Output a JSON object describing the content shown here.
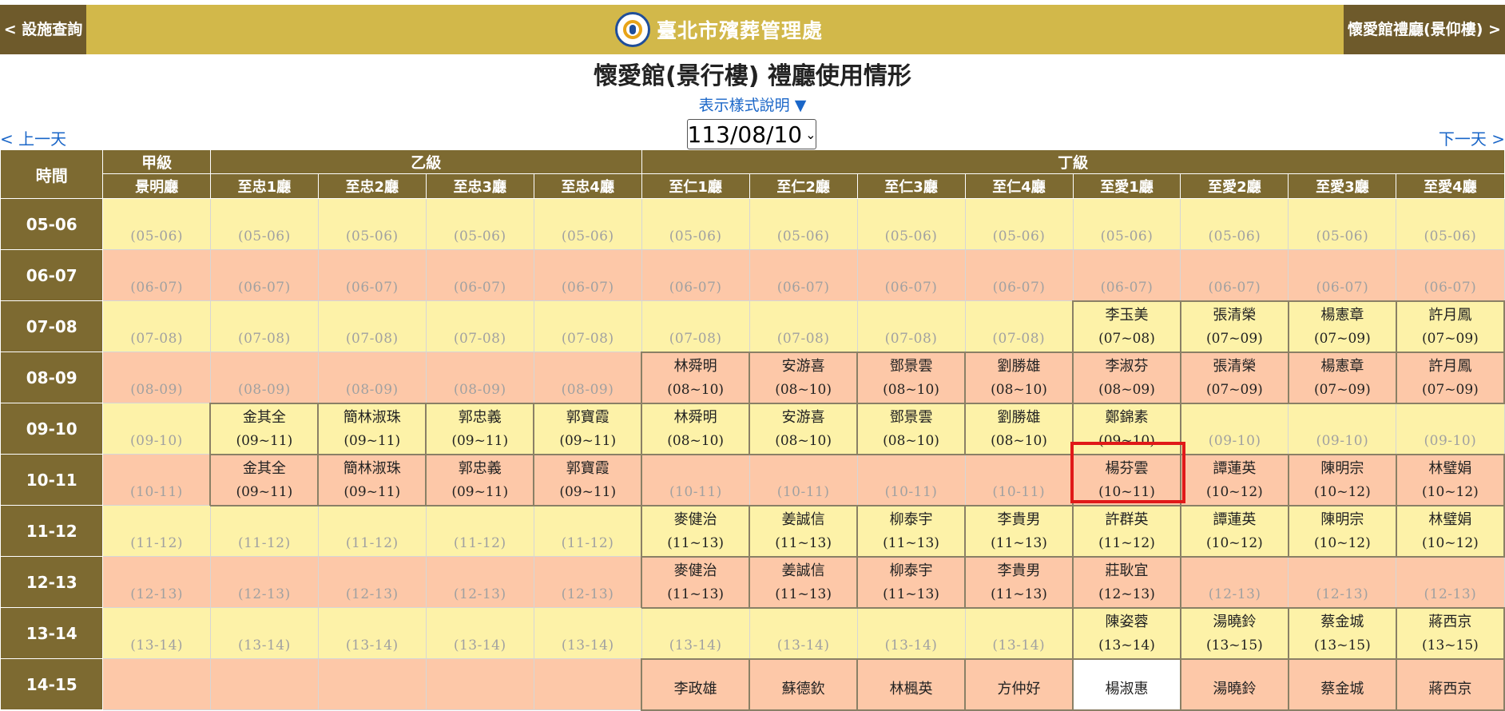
{
  "header": {
    "back_link": "< 設施查詢",
    "org_name": "臺北市殯葬管理處",
    "next_venue_link": "懷愛館禮廳(景仰樓) >"
  },
  "page_title": "懷愛館(景行樓) 禮廳使用情形",
  "legend_toggle": "表示樣式說明 ▼",
  "date_nav": {
    "prev": "< 上一天",
    "next": "下一天 >",
    "selected_date": "113/08/10"
  },
  "colors": {
    "banner": "#d2b84a",
    "header_cell": "#7d6a31",
    "row_yellow": "#fdf2a8",
    "row_peach": "#fdc8a8",
    "highlight": "#e01919",
    "link": "#1a66c8"
  },
  "grid": {
    "time_header": "時間",
    "grades": [
      {
        "label": "甲級",
        "span": 1
      },
      {
        "label": "乙級",
        "span": 4
      },
      {
        "label": "丁級",
        "span": 8
      }
    ],
    "halls": [
      "景明廳",
      "至忠1廳",
      "至忠2廳",
      "至忠3廳",
      "至忠4廳",
      "至仁1廳",
      "至仁2廳",
      "至仁3廳",
      "至仁4廳",
      "至愛1廳",
      "至愛2廳",
      "至愛3廳",
      "至愛4廳"
    ],
    "rows": [
      {
        "time": "05-06",
        "shade": "y",
        "cells": [
          {
            "free": "(05-06)"
          },
          {
            "free": "(05-06)"
          },
          {
            "free": "(05-06)"
          },
          {
            "free": "(05-06)"
          },
          {
            "free": "(05-06)"
          },
          {
            "free": "(05-06)"
          },
          {
            "free": "(05-06)"
          },
          {
            "free": "(05-06)"
          },
          {
            "free": "(05-06)"
          },
          {
            "free": "(05-06)"
          },
          {
            "free": "(05-06)"
          },
          {
            "free": "(05-06)"
          },
          {
            "free": "(05-06)"
          }
        ]
      },
      {
        "time": "06-07",
        "shade": "p",
        "cells": [
          {
            "free": "(06-07)"
          },
          {
            "free": "(06-07)"
          },
          {
            "free": "(06-07)"
          },
          {
            "free": "(06-07)"
          },
          {
            "free": "(06-07)"
          },
          {
            "free": "(06-07)"
          },
          {
            "free": "(06-07)"
          },
          {
            "free": "(06-07)"
          },
          {
            "free": "(06-07)"
          },
          {
            "free": "(06-07)"
          },
          {
            "free": "(06-07)"
          },
          {
            "free": "(06-07)"
          },
          {
            "free": "(06-07)"
          }
        ]
      },
      {
        "time": "07-08",
        "shade": "y",
        "cells": [
          {
            "free": "(07-08)"
          },
          {
            "free": "(07-08)"
          },
          {
            "free": "(07-08)"
          },
          {
            "free": "(07-08)"
          },
          {
            "free": "(07-08)"
          },
          {
            "free": "(07-08)"
          },
          {
            "free": "(07-08)"
          },
          {
            "free": "(07-08)"
          },
          {
            "free": "(07-08)"
          },
          {
            "name": "李玉美",
            "range": "(07~08)"
          },
          {
            "name": "張清榮",
            "range": "(07~09)"
          },
          {
            "name": "楊憲章",
            "range": "(07~09)"
          },
          {
            "name": "許月鳳",
            "range": "(07~09)"
          }
        ]
      },
      {
        "time": "08-09",
        "shade": "p",
        "cells": [
          {
            "free": "(08-09)"
          },
          {
            "free": "(08-09)"
          },
          {
            "free": "(08-09)"
          },
          {
            "free": "(08-09)"
          },
          {
            "free": "(08-09)"
          },
          {
            "name": "林舜明",
            "range": "(08~10)"
          },
          {
            "name": "安游喜",
            "range": "(08~10)"
          },
          {
            "name": "鄧景雲",
            "range": "(08~10)"
          },
          {
            "name": "劉勝雄",
            "range": "(08~10)"
          },
          {
            "name": "李淑芬",
            "range": "(08~09)"
          },
          {
            "name": "張清榮",
            "range": "(07~09)"
          },
          {
            "name": "楊憲章",
            "range": "(07~09)"
          },
          {
            "name": "許月鳳",
            "range": "(07~09)"
          }
        ]
      },
      {
        "time": "09-10",
        "shade": "y",
        "cells": [
          {
            "free": "(09-10)"
          },
          {
            "name": "金其全",
            "range": "(09~11)"
          },
          {
            "name": "簡林淑珠",
            "range": "(09~11)"
          },
          {
            "name": "郭忠義",
            "range": "(09~11)"
          },
          {
            "name": "郭寶霞",
            "range": "(09~11)"
          },
          {
            "name": "林舜明",
            "range": "(08~10)"
          },
          {
            "name": "安游喜",
            "range": "(08~10)"
          },
          {
            "name": "鄧景雲",
            "range": "(08~10)"
          },
          {
            "name": "劉勝雄",
            "range": "(08~10)"
          },
          {
            "name": "鄭錦素",
            "range": "(09~10)"
          },
          {
            "free": "(09-10)"
          },
          {
            "free": "(09-10)"
          },
          {
            "free": "(09-10)"
          }
        ]
      },
      {
        "time": "10-11",
        "shade": "p",
        "cells": [
          {
            "free": "(10-11)"
          },
          {
            "name": "金其全",
            "range": "(09~11)"
          },
          {
            "name": "簡林淑珠",
            "range": "(09~11)"
          },
          {
            "name": "郭忠義",
            "range": "(09~11)"
          },
          {
            "name": "郭寶霞",
            "range": "(09~11)"
          },
          {
            "free": "(10-11)"
          },
          {
            "free": "(10-11)"
          },
          {
            "free": "(10-11)"
          },
          {
            "free": "(10-11)"
          },
          {
            "name": "楊芬雲",
            "range": "(10~11)"
          },
          {
            "name": "譚蓮英",
            "range": "(10~12)"
          },
          {
            "name": "陳明宗",
            "range": "(10~12)"
          },
          {
            "name": "林璧娟",
            "range": "(10~12)"
          }
        ]
      },
      {
        "time": "11-12",
        "shade": "y",
        "cells": [
          {
            "free": "(11-12)"
          },
          {
            "free": "(11-12)"
          },
          {
            "free": "(11-12)"
          },
          {
            "free": "(11-12)"
          },
          {
            "free": "(11-12)"
          },
          {
            "name": "麥健治",
            "range": "(11~13)"
          },
          {
            "name": "姜誠信",
            "range": "(11~13)"
          },
          {
            "name": "柳泰宇",
            "range": "(11~13)"
          },
          {
            "name": "李貴男",
            "range": "(11~13)"
          },
          {
            "name": "許群英",
            "range": "(11~12)"
          },
          {
            "name": "譚蓮英",
            "range": "(10~12)"
          },
          {
            "name": "陳明宗",
            "range": "(10~12)"
          },
          {
            "name": "林璧娟",
            "range": "(10~12)"
          }
        ]
      },
      {
        "time": "12-13",
        "shade": "p",
        "cells": [
          {
            "free": "(12-13)"
          },
          {
            "free": "(12-13)"
          },
          {
            "free": "(12-13)"
          },
          {
            "free": "(12-13)"
          },
          {
            "free": "(12-13)"
          },
          {
            "name": "麥健治",
            "range": "(11~13)"
          },
          {
            "name": "姜誠信",
            "range": "(11~13)"
          },
          {
            "name": "柳泰宇",
            "range": "(11~13)"
          },
          {
            "name": "李貴男",
            "range": "(11~13)"
          },
          {
            "name": "莊耿宜",
            "range": "(12~13)"
          },
          {
            "free": "(12-13)"
          },
          {
            "free": "(12-13)"
          },
          {
            "free": "(12-13)"
          }
        ]
      },
      {
        "time": "13-14",
        "shade": "y",
        "cells": [
          {
            "free": "(13-14)"
          },
          {
            "free": "(13-14)"
          },
          {
            "free": "(13-14)"
          },
          {
            "free": "(13-14)"
          },
          {
            "free": "(13-14)"
          },
          {
            "free": "(13-14)"
          },
          {
            "free": "(13-14)"
          },
          {
            "free": "(13-14)"
          },
          {
            "free": "(13-14)"
          },
          {
            "name": "陳姿蓉",
            "range": "(13~14)"
          },
          {
            "name": "湯曉鈴",
            "range": "(13~15)"
          },
          {
            "name": "蔡金城",
            "range": "(13~15)"
          },
          {
            "name": "蔣西京",
            "range": "(13~15)"
          }
        ]
      },
      {
        "time": "14-15",
        "shade": "p",
        "cells": [
          {
            "free": ""
          },
          {
            "free": ""
          },
          {
            "free": ""
          },
          {
            "free": ""
          },
          {
            "free": ""
          },
          {
            "name": "李政雄",
            "range": ""
          },
          {
            "name": "蘇德欽",
            "range": ""
          },
          {
            "name": "林楓英",
            "range": ""
          },
          {
            "name": "方仲好",
            "range": ""
          },
          {
            "name": "楊淑惠",
            "range": "",
            "shade": "w"
          },
          {
            "name": "湯曉鈴",
            "range": ""
          },
          {
            "name": "蔡金城",
            "range": ""
          },
          {
            "name": "蔣西京",
            "range": ""
          }
        ]
      }
    ]
  }
}
